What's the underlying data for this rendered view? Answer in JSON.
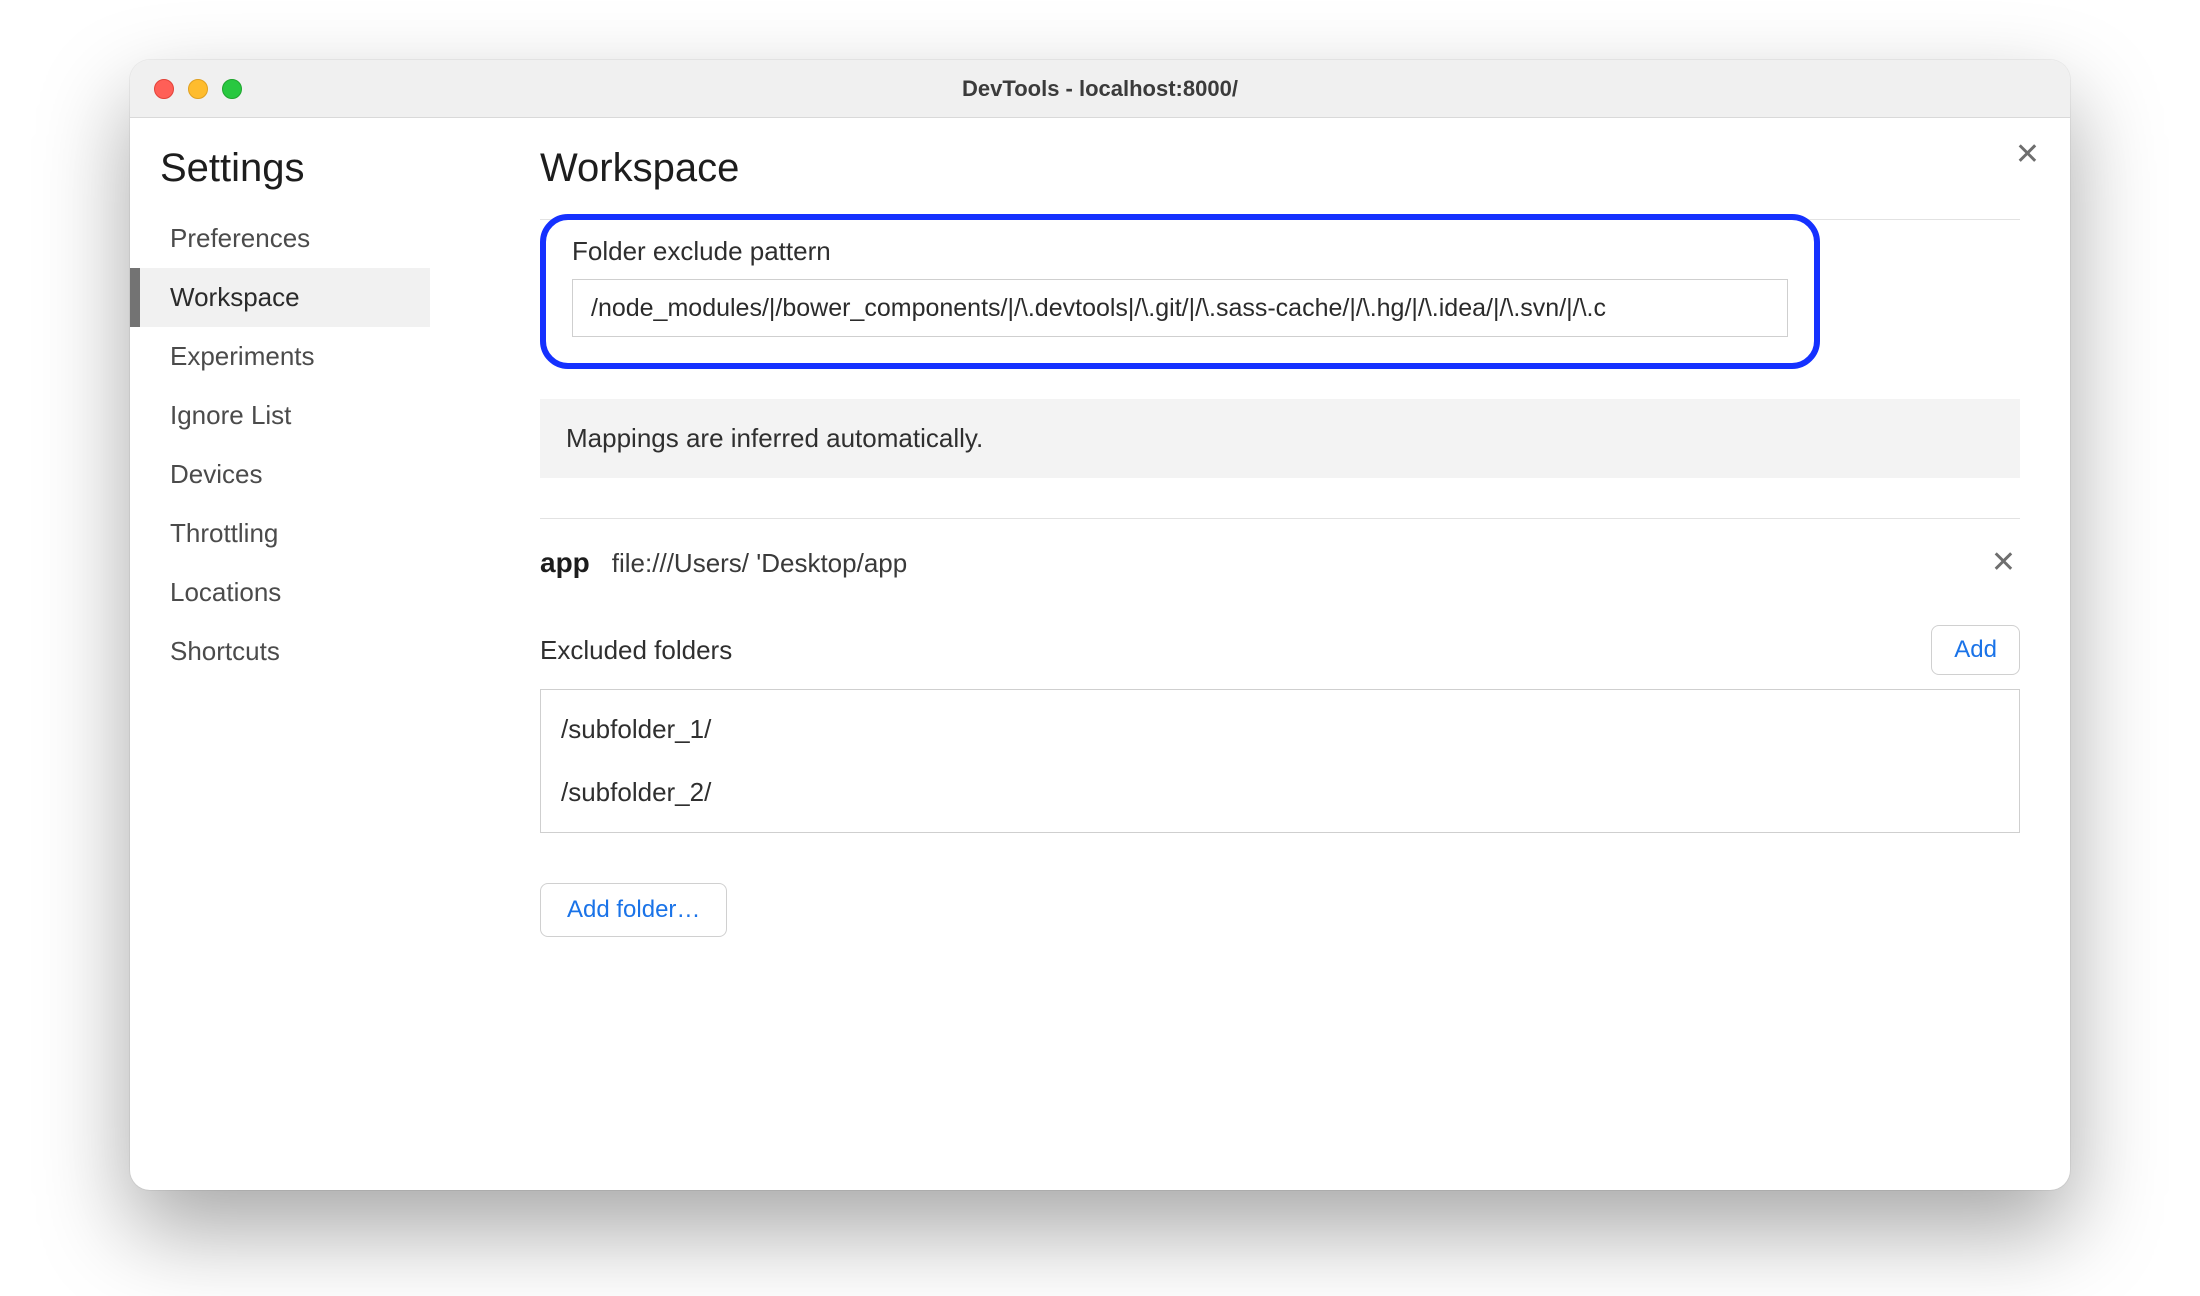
{
  "window_title": "DevTools - localhost:8000/",
  "settings_title": "Settings",
  "sidebar": {
    "items": [
      {
        "label": "Preferences"
      },
      {
        "label": "Workspace"
      },
      {
        "label": "Experiments"
      },
      {
        "label": "Ignore List"
      },
      {
        "label": "Devices"
      },
      {
        "label": "Throttling"
      },
      {
        "label": "Locations"
      },
      {
        "label": "Shortcuts"
      }
    ],
    "selected_index": 1
  },
  "main": {
    "title": "Workspace",
    "exclude_pattern_label": "Folder exclude pattern",
    "exclude_pattern_value": "/node_modules/|/bower_components/|/\\.devtools|/\\.git/|/\\.sass-cache/|/\\.hg/|/\\.idea/|/\\.svn/|/\\.c",
    "info_text": "Mappings are inferred automatically.",
    "folder": {
      "name": "app",
      "path": "file:///Users/       'Desktop/app",
      "excluded_label": "Excluded folders",
      "add_label": "Add",
      "excluded": [
        "/subfolder_1/",
        "/subfolder_2/"
      ]
    },
    "add_folder_label": "Add folder…"
  }
}
